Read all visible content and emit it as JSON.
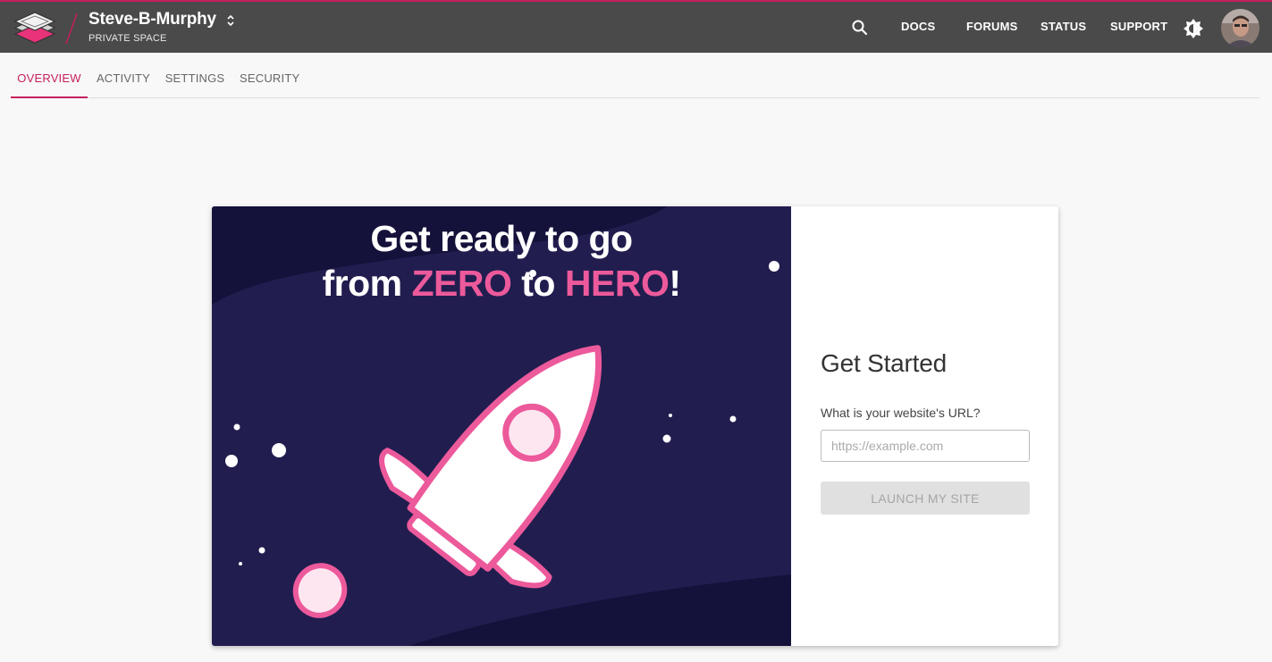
{
  "header": {
    "space_name": "Steve-B-Murphy",
    "space_type": "PRIVATE SPACE",
    "nav": {
      "docs": "DOCS",
      "forums": "FORUMS",
      "status": "STATUS",
      "support": "SUPPORT"
    },
    "icons": [
      "logo-icon",
      "switch-space-icon",
      "search-icon",
      "theme-toggle-icon",
      "avatar"
    ]
  },
  "tabs": [
    {
      "label": "OVERVIEW",
      "active": true
    },
    {
      "label": "ACTIVITY",
      "active": false
    },
    {
      "label": "SETTINGS",
      "active": false
    },
    {
      "label": "SECURITY",
      "active": false
    }
  ],
  "hero": {
    "line1": "Get ready to go",
    "line2_prefix": "from ",
    "zero": "ZERO",
    "to": " to ",
    "hero": "HERO",
    "suffix": "!",
    "illustration": "rocket-illustration"
  },
  "get_started": {
    "title": "Get Started",
    "url_label": "What is your website's URL?",
    "url_placeholder": "https://example.com",
    "url_value": "",
    "launch_label": "LAUNCH MY SITE"
  },
  "colors": {
    "accent": "#c51f5d",
    "topbar": "#4a4a4a",
    "hero_bg": "#211d4f",
    "hero_pink": "#ec5a9b"
  }
}
